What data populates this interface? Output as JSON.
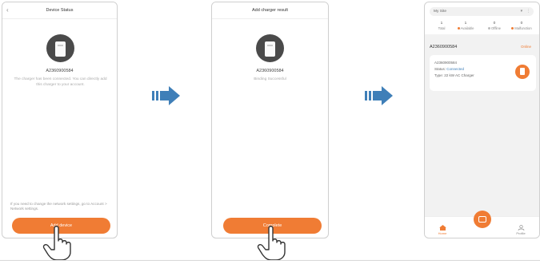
{
  "screen1": {
    "title": "Device Status",
    "back_glyph": "‹",
    "serial": "A2360900584",
    "description": "The charger has been connected. You can directly add this charger to your account.",
    "network_note": "If you need to change the network settings, go to Account > Network settings.",
    "button_label": "Add device"
  },
  "screen2": {
    "title": "Add charger result",
    "serial": "A2360900584",
    "status": "Binding Successful",
    "button_label": "Complete"
  },
  "screen3": {
    "location_label": "My Site",
    "location_chevron": "▾",
    "more_glyph": "⋮",
    "stats": [
      {
        "num": "1",
        "label": "Total",
        "dot": ""
      },
      {
        "num": "1",
        "label": "Available",
        "dot": "#f07c34"
      },
      {
        "num": "0",
        "label": "Offline",
        "dot": "#bbb"
      },
      {
        "num": "0",
        "label": "Malfunction",
        "dot": "#f07c34"
      }
    ],
    "site_id": "A2360900584",
    "site_status": "Online",
    "card": {
      "serial": "A2360900584",
      "status_prefix": "Status:",
      "status_value": "Connected",
      "type": "Type: 22 kW AC Charger"
    },
    "tabs": [
      "Home",
      "Profile"
    ]
  },
  "colors": {
    "accent": "#f07c34",
    "arrow": "#3f7fb8"
  }
}
